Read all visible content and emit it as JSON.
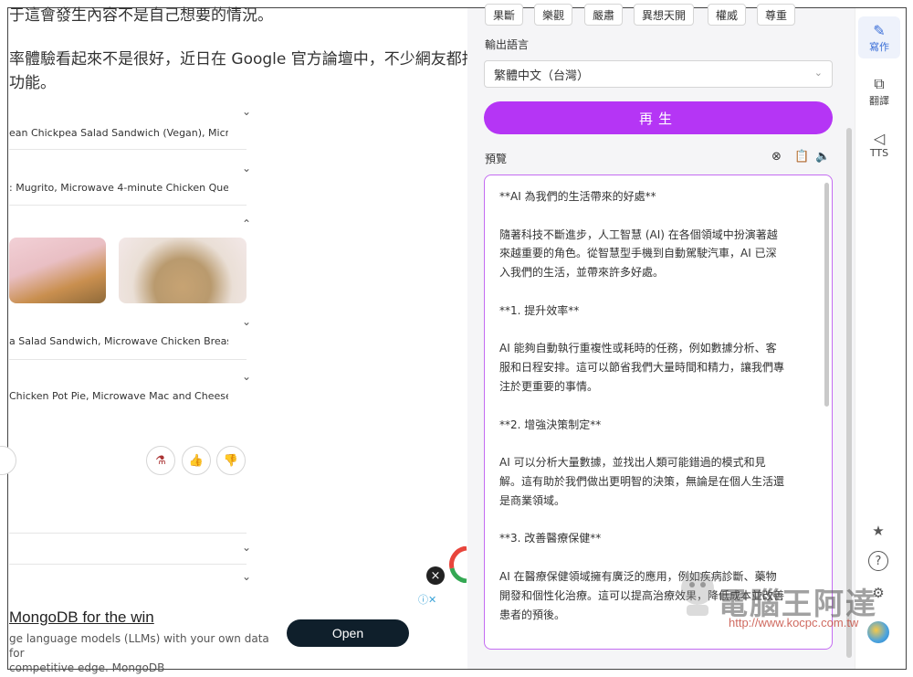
{
  "article": {
    "line1": "于這會發生內容不是自己想要的情況。",
    "line2": "率體驗看起來不是很好，近日在 Google 官方論壇中，不少網友都抱怨",
    "line3": "功能。"
  },
  "accordion": [
    {
      "text": "ean Chickpea Salad Sandwich (Vegan), Micro...",
      "chevron": "⌄"
    },
    {
      "text": ": Mugrito, Microwave 4-minute Chicken Que...",
      "chevron": "⌄"
    },
    {
      "text": "",
      "chevron": "⌃"
    },
    {
      "text": "a Salad Sandwich, Microwave Chicken Breast",
      "chevron": "⌄"
    },
    {
      "text": "Chicken Pot Pie, Microwave Mac and Cheese",
      "chevron": "⌄"
    },
    {
      "text": "",
      "chevron": "⌄"
    },
    {
      "text": "",
      "chevron": "⌄"
    }
  ],
  "ad": {
    "title": "MongoDB for the win",
    "desc_line1": "ge language models (LLMs) with your own data for",
    "desc_line2": "competitive edge. MongoDB",
    "open": "Open",
    "close_icon": "×",
    "choices": "ⓘ✕"
  },
  "panel": {
    "tones": [
      "果斷",
      "樂觀",
      "嚴肅",
      "異想天開",
      "權威",
      "尊重"
    ],
    "output_language_label": "輸出語言",
    "output_language_value": "繁體中文（台灣）",
    "regenerate": "再生",
    "preview_label": "預覽",
    "preview_lines": [
      "**AI 為我們的生活帶來的好處**",
      "",
      "隨著科技不斷進步，人工智慧 (AI) 在各個領域中扮演著越",
      "來越重要的角色。從智慧型手機到自動駕駛汽車，AI 已深",
      "入我們的生活，並帶來許多好處。",
      "",
      "**1. 提升效率**",
      "",
      "AI 能夠自動執行重複性或耗時的任務，例如數據分析、客",
      "服和日程安排。這可以節省我們大量時間和精力，讓我們專",
      "注於更重要的事情。",
      "",
      "**2. 增強決策制定**",
      "",
      "AI 可以分析大量數據，並找出人類可能錯過的模式和見",
      "解。這有助於我們做出更明智的決策，無論是在個人生活還",
      "是商業領域。",
      "",
      "**3. 改善醫療保健**",
      "",
      "AI 在醫療保健領域擁有廣泛的應用，例如疾病診斷、藥物",
      "開發和個性化治療。這可以提高治療效果，降低成本並改善",
      "患者的預後。"
    ]
  },
  "sidebar": {
    "items": [
      {
        "icon": "✎",
        "label": "寫作"
      },
      {
        "icon": "⧉",
        "label": "翻譯"
      },
      {
        "icon": "◁",
        "label": "TTS"
      }
    ],
    "bottom": [
      "★",
      "?",
      "⚙"
    ]
  },
  "watermark": {
    "text": "電腦王阿達",
    "url": "http://www.kocpc.com.tw"
  },
  "colors": {
    "accent": "#b535f5",
    "preview_border": "#c46cf2",
    "ad_button": "#0f1f2b"
  }
}
